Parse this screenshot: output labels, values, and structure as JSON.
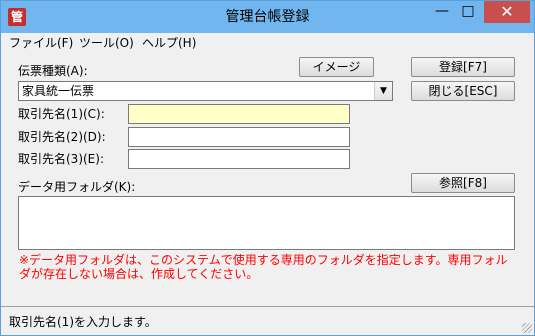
{
  "window": {
    "title": "管理台帳登録",
    "icon_glyph": "管",
    "controls": {
      "minimize": "—",
      "maximize": "□",
      "close": "✕"
    }
  },
  "menu": [
    {
      "label": "ファイル(F)"
    },
    {
      "label": "ツール(O)"
    },
    {
      "label": "ヘルプ(H)"
    }
  ],
  "form": {
    "slip_type_label": "伝票種類(A):",
    "slip_type_value": "家具統一伝票",
    "client1_label": "取引先名(1)(C):",
    "client1_value": "",
    "client2_label": "取引先名(2)(D):",
    "client2_value": "",
    "client3_label": "取引先名(3)(E):",
    "client3_value": "",
    "data_folder_label": "データ用フォルダ(K):",
    "data_folder_value": ""
  },
  "buttons": {
    "image": "イメージ",
    "register": "登録[F7]",
    "close": "閉じる[ESC]",
    "browse": "参照[F8]"
  },
  "note": "※データ用フォルダは、このシステムで使用する専用のフォルダを指定します。専用フォルダが存在しない場合は、作成してください。",
  "status": "取引先名(1)を入力します。",
  "colors": {
    "titlebar": "#72b6ef",
    "close_button": "#c7504e",
    "focused_input": "#ffffc8",
    "note_text": "#ff0000"
  },
  "icons": {
    "dropdown": "chevron-down-icon",
    "app": "app-icon"
  }
}
